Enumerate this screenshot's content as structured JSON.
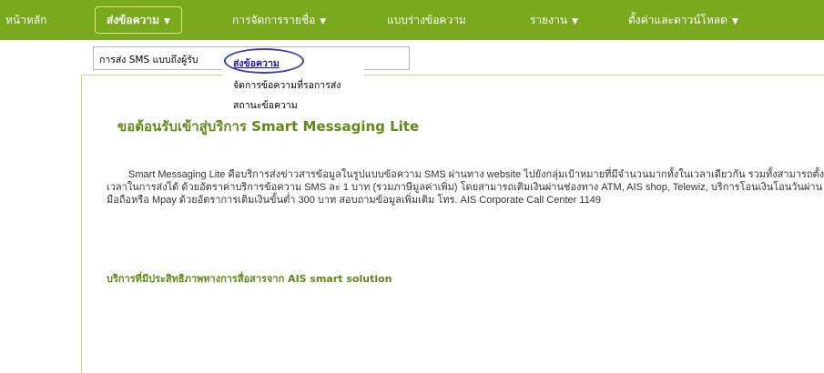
{
  "nav": {
    "home": "หน้าหลัก",
    "send_message": "ส่งข้อความ",
    "manage_list": "การจัดการรายชื่อ",
    "draft": "แบบร่างข้อความ",
    "report": "รายงาน",
    "settings_download": "ตั้งค่าและดาวน์โหลด",
    "caret": "▼"
  },
  "submenu": {
    "sms_to_recipient": "การส่ง SMS แบบถึงผู้รับ"
  },
  "dropdown": {
    "items": [
      "ส่งข้อความ",
      "จัดการข้อความที่รอการส่ง",
      "สถานะข้อความ"
    ]
  },
  "content": {
    "welcome": "ขอต้อนรับเข้าสู่บริการ Smart Messaging Lite",
    "intro": "Smart Messaging Lite คือบริการส่งข่าวสารข้อมูลในรูปแบบข้อความ SMS ผ่านทาง website ไปยังกลุ่มเป้าหมายที่มีจำนวนมากทั้งในเวลาเดียวกัน รวมทั้งสามารถตั้งเวลาในการส่งได้ ด้วยอัตราค่าบริการข้อความ SMS ละ 1 บาท (รวมภาษีมูลค่าเพิ่ม) โดยสามารถเติมเงินผ่านช่องทาง ATM, AIS shop, Telewiz, บริการโอนเงินโอนวันผ่านมือถือหรือ Mpay ด้วยอัตราการเติมเงินขั้นต่ำ 300 บาท สอบถามข้อมูลเพิ่มเติม โทร. AIS Corporate Call Center 1149",
    "services": "บริการที่มีประสิทธิภาพทางการสื่อสารจาก AIS smart solution"
  },
  "colors": {
    "nav_bg": "#79a91d",
    "accent_text": "#5f8a14",
    "highlight_ring": "#3b3fc6",
    "active_link": "#1a14c8"
  }
}
